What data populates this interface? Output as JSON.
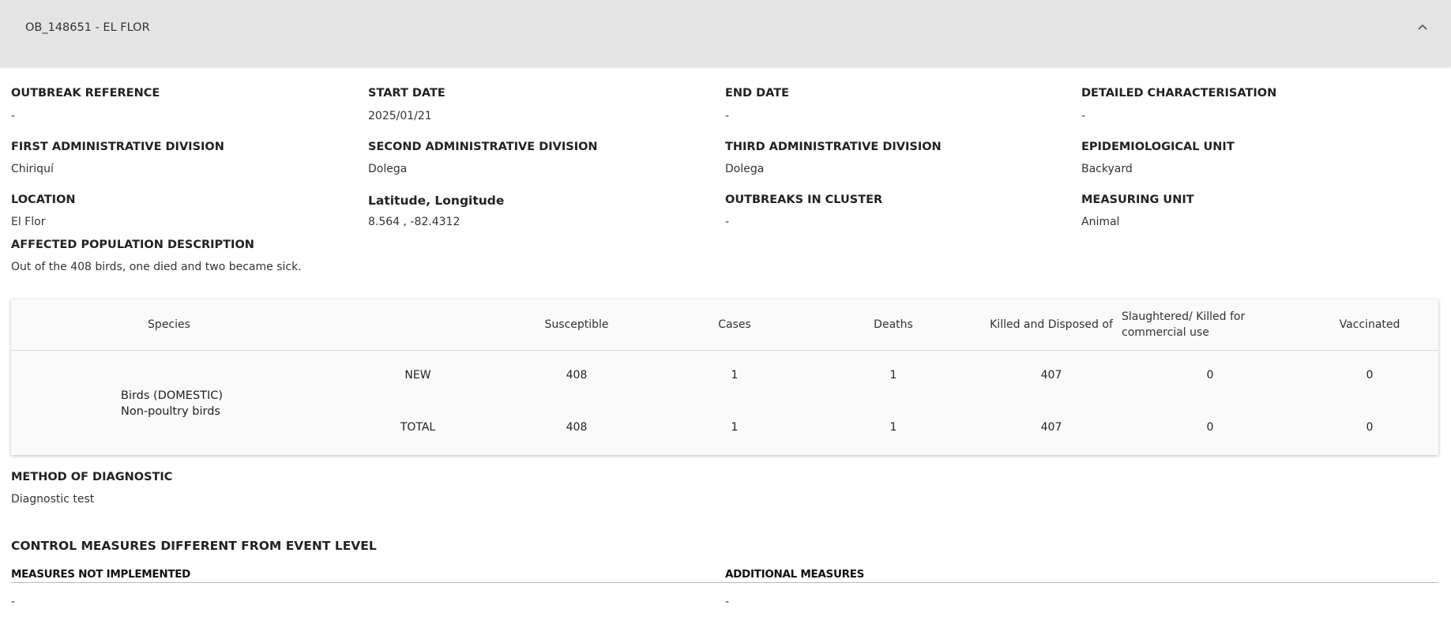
{
  "header": {
    "title": "OB_148651 - EL FLOR"
  },
  "fields": {
    "outbreak_reference": {
      "label": "OUTBREAK REFERENCE",
      "value": "-"
    },
    "start_date": {
      "label": "START DATE",
      "value": "2025/01/21"
    },
    "end_date": {
      "label": "END DATE",
      "value": "-"
    },
    "detailed_characterisation": {
      "label": "DETAILED CHARACTERISATION",
      "value": "-"
    },
    "first_admin_division": {
      "label": "FIRST ADMINISTRATIVE DIVISION",
      "value": "Chiriquí"
    },
    "second_admin_division": {
      "label": "SECOND ADMINISTRATIVE DIVISION",
      "value": "Dolega"
    },
    "third_admin_division": {
      "label": "THIRD ADMINISTRATIVE DIVISION",
      "value": "Dolega"
    },
    "epidemiological_unit": {
      "label": "EPIDEMIOLOGICAL UNIT",
      "value": "Backyard"
    },
    "location": {
      "label": "LOCATION",
      "value": "El Flor"
    },
    "lat_long": {
      "label": "Latitude, Longitude",
      "value": "8.564 , -82.4312"
    },
    "outbreaks_in_cluster": {
      "label": "OUTBREAKS IN CLUSTER",
      "value": "-"
    },
    "measuring_unit": {
      "label": "MEASURING UNIT",
      "value": "Animal"
    },
    "affected_population": {
      "label": "AFFECTED POPULATION DESCRIPTION",
      "value": "Out of the 408 birds, one died and two became sick."
    }
  },
  "table": {
    "headers": {
      "species": "Species",
      "susceptible": "Susceptible",
      "cases": "Cases",
      "deaths": "Deaths",
      "killed": "Killed and Disposed of",
      "slaughtered": "Slaughtered/ Killed for commercial use",
      "vaccinated": "Vaccinated"
    },
    "species_line1": "Birds (DOMESTIC)",
    "species_line2": "Non-poultry birds",
    "rows": [
      {
        "type": "NEW",
        "susceptible": "408",
        "cases": "1",
        "deaths": "1",
        "killed": "407",
        "slaughtered": "0",
        "vaccinated": "0"
      },
      {
        "type": "TOTAL",
        "susceptible": "408",
        "cases": "1",
        "deaths": "1",
        "killed": "407",
        "slaughtered": "0",
        "vaccinated": "0"
      }
    ]
  },
  "diagnostic": {
    "label": "METHOD OF DIAGNOSTIC",
    "value": "Diagnostic test"
  },
  "control_measures": {
    "title": "CONTROL MEASURES DIFFERENT FROM EVENT LEVEL",
    "not_implemented_label": "MEASURES NOT IMPLEMENTED",
    "not_implemented_value": "-",
    "additional_label": "ADDITIONAL MEASURES",
    "additional_value": "-"
  }
}
